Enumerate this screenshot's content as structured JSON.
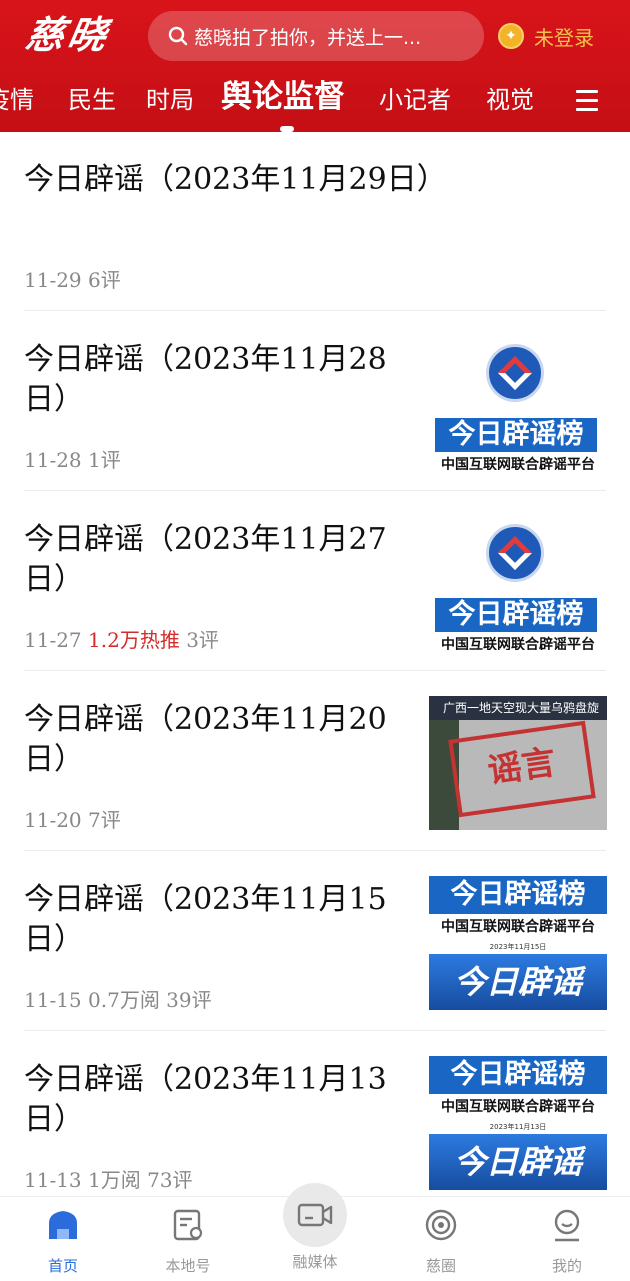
{
  "app": {
    "logo_text": "慈晓"
  },
  "header": {
    "search_placeholder": "慈晓拍了拍你，并送上一...",
    "login_label": "未登录",
    "colors": {
      "primary": "#d8141a",
      "login_text": "#f3c24a",
      "coin": "#f4b227"
    }
  },
  "tabs": [
    {
      "label": "疫情"
    },
    {
      "label": "民生"
    },
    {
      "label": "时局"
    },
    {
      "label": "舆论监督",
      "active": true
    },
    {
      "label": "小记者"
    },
    {
      "label": "视觉"
    }
  ],
  "articles": [
    {
      "title": "今日辟谣（2023年11月29日）",
      "date": "11-29",
      "stats": "6评",
      "thumbnail": "none"
    },
    {
      "title": "今日辟谣（2023年11月28日）",
      "date": "11-28",
      "stats": "1评",
      "thumbnail": "emblem-banner",
      "thumb_banner": "今日辟谣榜",
      "thumb_sub": "中国互联网联合辟谣平台"
    },
    {
      "title": "今日辟谣（2023年11月27日）",
      "date": "11-27",
      "hot": "1.2万热推",
      "stats": "3评",
      "thumbnail": "emblem-banner",
      "thumb_banner": "今日辟谣榜",
      "thumb_sub": "中国互联网联合辟谣平台"
    },
    {
      "title": "今日辟谣（2023年11月20日）",
      "date": "11-20",
      "stats": "7评",
      "thumbnail": "photo",
      "thumb_head": "广西一地天空现大量乌鸦盘旋",
      "thumb_stamp": "谣言"
    },
    {
      "title": "今日辟谣（2023年11月15日）",
      "date": "11-15",
      "stats": "0.7万阅 39评",
      "thumbnail": "card",
      "thumb_banner": "今日辟谣榜",
      "thumb_sub": "中国互联网联合辟谣平台",
      "thumb_date": "2023年11月15日",
      "thumb_big": "今日辟谣"
    },
    {
      "title": "今日辟谣（2023年11月13日）",
      "date": "11-13",
      "stats": "1万阅 73评",
      "thumbnail": "card",
      "thumb_banner": "今日辟谣榜",
      "thumb_sub": "中国互联网联合辟谣平台",
      "thumb_date": "2023年11月13日",
      "thumb_big": "今日辟谣"
    }
  ],
  "bottom_nav": [
    {
      "label": "首页",
      "icon": "home-icon",
      "active": true
    },
    {
      "label": "本地号",
      "icon": "local-account-icon"
    },
    {
      "label": "融媒体",
      "icon": "video-camera-icon"
    },
    {
      "label": "慈圈",
      "icon": "circle-icon"
    },
    {
      "label": "我的",
      "icon": "profile-icon"
    }
  ],
  "colors": {
    "hot_text": "#d22c2c",
    "nav_active": "#2a6cdb",
    "thumb_blue": "#1a66c4"
  }
}
